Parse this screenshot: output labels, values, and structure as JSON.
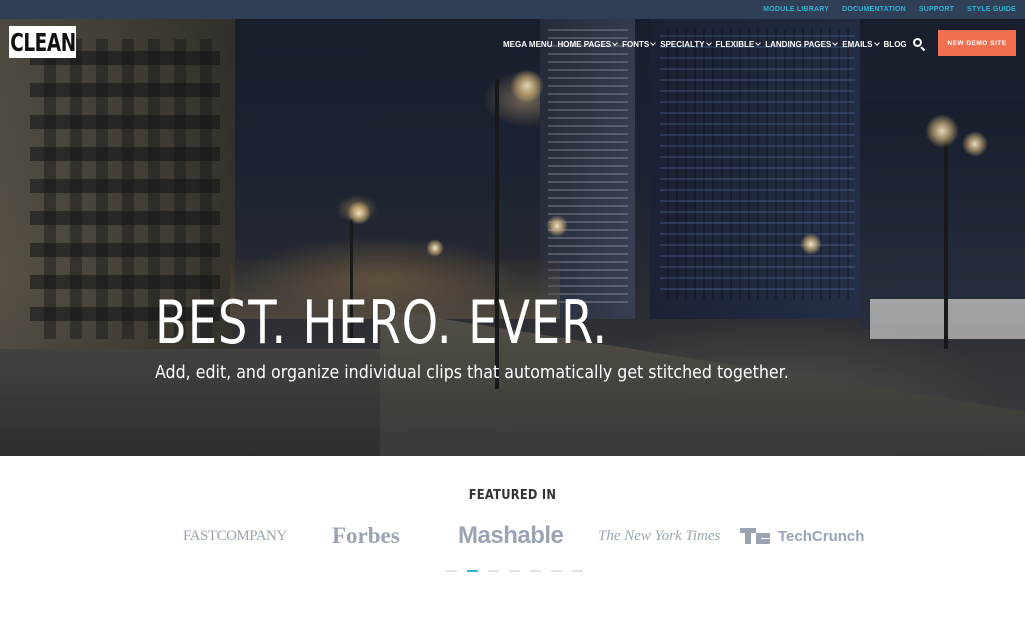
{
  "topbar": {
    "links": [
      "MODULE LIBRARY",
      "DOCUMENTATION",
      "SUPPORT",
      "STYLE GUIDE"
    ]
  },
  "header": {
    "logo_text": "CLEAN",
    "nav": [
      {
        "label": "MEGA MENU",
        "has_dropdown": false
      },
      {
        "label": "HOME PAGES",
        "has_dropdown": true
      },
      {
        "label": "FONTS",
        "has_dropdown": true
      },
      {
        "label": "SPECIALTY",
        "has_dropdown": true
      },
      {
        "label": "FLEXIBLE",
        "has_dropdown": true
      },
      {
        "label": "LANDING PAGES",
        "has_dropdown": true
      },
      {
        "label": "EMAILS",
        "has_dropdown": true
      },
      {
        "label": "BLOG",
        "has_dropdown": false
      }
    ],
    "search_icon": "search-icon",
    "cta_label": "NEW DEMO SITE"
  },
  "hero": {
    "title": "BEST. HERO. EVER.",
    "subtitle": "Add, edit, and organize individual clips that automatically get stitched together."
  },
  "featured": {
    "label": "FEATURED IN",
    "logos": [
      "FASTCOMPANY",
      "Forbes",
      "Mashable",
      "The New York Times",
      "TechCrunch"
    ],
    "carousel_dots": 7,
    "active_dot": 1
  },
  "colors": {
    "topbar_bg": "#2f3f56",
    "topbar_link": "#2eb3d6",
    "cta_bg": "#f26f4f",
    "logo_gray": "#9aa4b2",
    "dot_active": "#2eb3d6"
  }
}
